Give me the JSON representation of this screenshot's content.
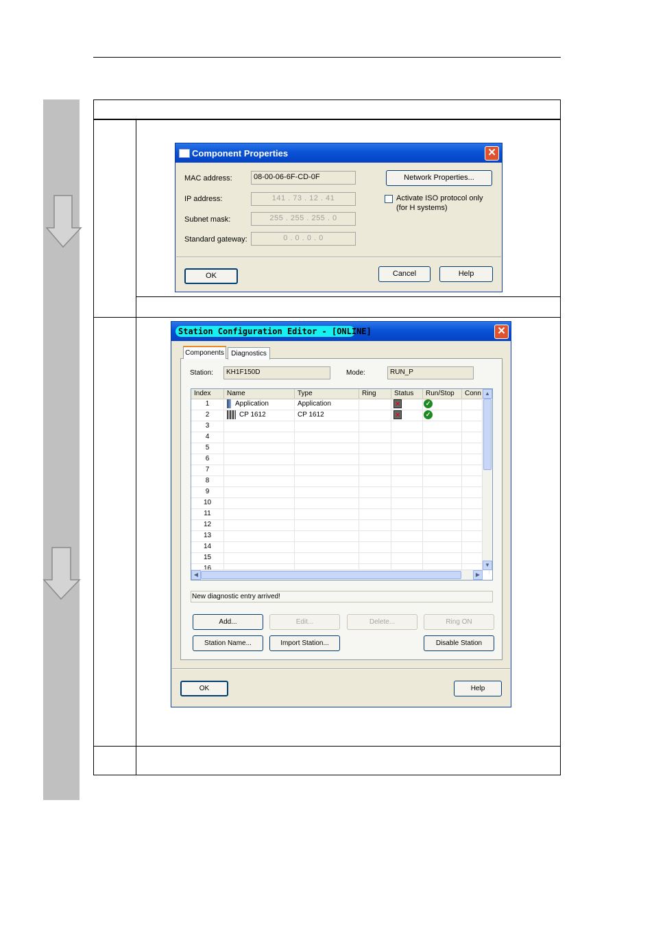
{
  "component_properties": {
    "title": "Component Properties",
    "mac_label": "MAC address:",
    "mac_value": "08-00-06-6F-CD-0F",
    "ip_label": "IP address:",
    "ip_value": "141  .  73  .  12  .  41",
    "subnet_label": "Subnet mask:",
    "subnet_value": "255  .  255  .  255  .  0",
    "gateway_label": "Standard gateway:",
    "gateway_value": "0  .  0  .  0  .  0",
    "network_props_button": "Network Properties...",
    "iso_checkbox_label": "Activate ISO protocol only",
    "iso_checkbox_sub": "(for H systems)",
    "ok_button": "OK",
    "cancel_button": "Cancel",
    "help_button": "Help",
    "close_symbol": "✕"
  },
  "station_config": {
    "title": "Station Configuration Editor - [ONLINE]",
    "close_symbol": "✕",
    "tabs": [
      "Components",
      "Diagnostics"
    ],
    "station_label": "Station:",
    "station_value": "KH1F150D",
    "mode_label": "Mode:",
    "mode_value": "RUN_P",
    "columns": [
      "Index",
      "Name",
      "Type",
      "Ring",
      "Status",
      "Run/Stop",
      "Conn"
    ],
    "rows": [
      {
        "index": "1",
        "name": "Application",
        "type": "Application",
        "status_icon": "error-icon",
        "runstop_icon": "ok-check-icon"
      },
      {
        "index": "2",
        "name": "CP 1612",
        "type": "CP 1612",
        "status_icon": "error-icon",
        "runstop_icon": "ok-check-icon"
      },
      {
        "index": "3",
        "name": "",
        "type": ""
      },
      {
        "index": "4",
        "name": "",
        "type": ""
      },
      {
        "index": "5",
        "name": "",
        "type": ""
      },
      {
        "index": "6",
        "name": "",
        "type": ""
      },
      {
        "index": "7",
        "name": "",
        "type": ""
      },
      {
        "index": "8",
        "name": "",
        "type": ""
      },
      {
        "index": "9",
        "name": "",
        "type": ""
      },
      {
        "index": "10",
        "name": "",
        "type": ""
      },
      {
        "index": "11",
        "name": "",
        "type": ""
      },
      {
        "index": "12",
        "name": "",
        "type": ""
      },
      {
        "index": "13",
        "name": "",
        "type": ""
      },
      {
        "index": "14",
        "name": "",
        "type": ""
      },
      {
        "index": "15",
        "name": "",
        "type": ""
      },
      {
        "index": "16",
        "name": "",
        "type": ""
      }
    ],
    "status_message": "New diagnostic entry arrived!",
    "buttons": {
      "add": "Add...",
      "edit": "Edit...",
      "delete": "Delete...",
      "ring_on": "Ring ON",
      "station_name": "Station Name...",
      "import_station": "Import Station...",
      "disable_station": "Disable Station",
      "ok": "OK",
      "help": "Help"
    }
  },
  "colors": {
    "sidebar": "#c0c0c0",
    "titlebar": "#0a52d6",
    "title_highlight": "#16f0f0",
    "dialog_bg": "#ece9d8"
  }
}
